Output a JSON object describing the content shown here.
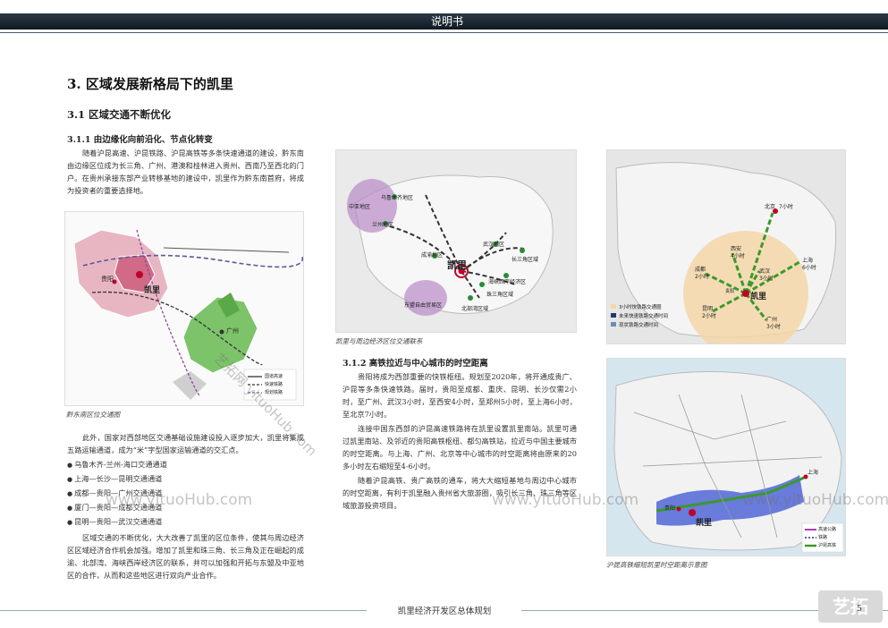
{
  "header": {
    "title": "说明书"
  },
  "section": {
    "title": "3. 区域发展新格局下的凯里",
    "subsection": "3.1  区域交通不断优化",
    "subsubsection_1": "3.1.1  由边缘化向前沿化、节点化转变",
    "subsubsection_2": "3.1.2  高铁拉近与中心城市的时空距离"
  },
  "left_column": {
    "para1": "随着沪昆高速、沪昆铁路、沪昆高铁等多条快速通道的建设，黔东南由边缘区位成为长三角、广州、港澳和桂林进入贵州、西南乃至西北的门户。在贵州承接东部产业转移基地的建设中，凯里作为黔东南首府，将成为投资者的重要选择地。",
    "para2": "此外，国家对西部地区交通基础设施建设投入逐步加大，凯里将集成五路运输通道，成为“米”字型国家运输通道的交汇点。",
    "bullets": [
      "乌鲁木齐-兰州-海口交通通道",
      "上海—长沙—昆明交通通道",
      "成都—贵阳—广州交通通道",
      "厦门—贵阳—成都交通通道",
      "昆明—贵阳—武汉交通通道"
    ],
    "para3": "区域交通的不断优化，大大改善了凯里的区位条件，使其与周边经济区区域经济合作机会加强。增加了凯里和珠三角、长三角及正在崛起的成渝、北部湾、海峡西岸经济区的联系，并可以加强和开拓与东盟及中亚地区的合作，从而和这些地区进行双向产业合作。"
  },
  "middle_column": {
    "para1": "贵阳将成为西部重要的快铁枢纽。规划至2020年，将开通成贵广、沪昆等多条快速铁路。届时，贵阳至成都、重庆、昆明、长沙仅需2小时，至广州、武汉3小时，至西安4小时，至郑州5小时，至上海6小时，至北京7小时。",
    "para2": "连接中国东西部的沪昆高速铁路将在凯里设置凯里南站。凯里可通过凯里南站、及邻近的贵阳高铁枢纽、都匀高铁站，拉近与中国主要城市的时空距离。与上海、广州、北京等中心城市的时空距离将由原来的20多小时左右缩短至4-6小时。",
    "para3": "随着沪昆高铁、贵广高铁的通车，将大大缩短基地与周边中心城市的时空距离，有利于凯里融入贵州省大旅游圈，吸引长三角、珠三角等区域旅游投资项目。"
  },
  "figures": {
    "fig1": {
      "caption": "黔东南区位交通图",
      "labels": {
        "city": "凯里",
        "guiyang": "贵阳",
        "guangzhou": "广州"
      },
      "legend": [
        "国道高速",
        "快速铁路",
        "规划铁路"
      ]
    },
    "fig2": {
      "caption": "凯里与周边经济区位交通联系",
      "labels": [
        "乌鲁木齐地区",
        "中亚地区",
        "兰州地区",
        "成渝地区",
        "武汉地区",
        "长三角区域",
        "海峡西岸经济区",
        "珠三角区域",
        "北部湾区域",
        "东盟自由贸易区",
        "凯里"
      ]
    },
    "fig3": {
      "labels": [
        "北京",
        "7小时",
        "上海",
        "6小时",
        "西安",
        "4小时",
        "成都",
        "2小时",
        "武汉",
        "3小时",
        "昆明",
        "2小时",
        "广州",
        "3小时",
        "凯里",
        "贵阳"
      ],
      "legend": [
        "3小时快铁路交通圈",
        "未来快速铁路交通时间",
        "现状铁路交通时间"
      ]
    },
    "fig4": {
      "caption": "沪昆高铁缩短凯里时空距离示意图",
      "labels": [
        "凯里",
        "上海",
        "贵阳"
      ],
      "legend": [
        "高速公路",
        "铁路",
        "沪昆高铁"
      ]
    }
  },
  "watermarks": [
    "www.yituoHub.com",
    "www.yituoHub.com",
    "www.yituoHub.com",
    "艺拓网 yituoHub.com"
  ],
  "footer": {
    "title": "凯里经济开发区总体规划",
    "page_number": "5",
    "logo_text": "艺拓"
  },
  "colors": {
    "header_band": "#1f2d38",
    "map_pink": "#e0a0b0",
    "map_green": "#7cc36a",
    "map_purple": "#b07ac0",
    "circle_fill": "#f3d6a8",
    "blue_region": "#5a6ed8"
  }
}
